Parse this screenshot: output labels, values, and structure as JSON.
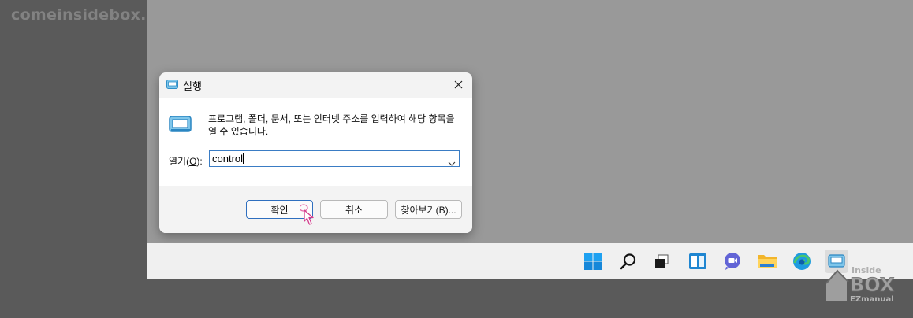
{
  "watermark": "comeinsidebox.com",
  "dialog": {
    "title": "실행",
    "description": "프로그램, 폴더, 문서, 또는 인터넷 주소를 입력하여 해당 항목을 열 수 있습니다.",
    "open_label": "열기(",
    "open_hotkey": "O",
    "open_label_end": "):",
    "input_value": "control",
    "buttons": {
      "ok": "확인",
      "cancel": "취소",
      "browse": "찾아보기(B)..."
    }
  },
  "taskbar": {
    "icons": [
      "windows-start-icon",
      "search-icon",
      "task-view-icon",
      "widgets-icon",
      "teams-chat-icon",
      "file-explorer-icon",
      "edge-icon",
      "run-app-icon"
    ]
  },
  "logo": {
    "line1": "Inside",
    "line2": "BOX",
    "line3": "EZmanual"
  },
  "colors": {
    "accent": "#0067c0",
    "desktop": "#999999",
    "outer": "#5a5a5a"
  }
}
